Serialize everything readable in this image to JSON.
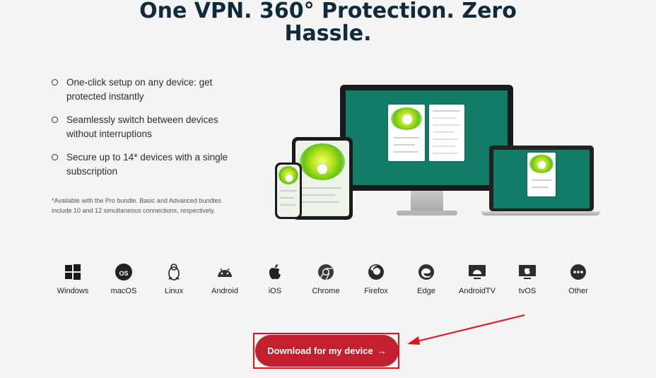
{
  "headline": "One VPN. 360° Protection. Zero Hassle.",
  "features": [
    "One-click setup on any device: get protected instantly",
    "Seamlessly switch between devices without interruptions",
    "Secure up to 14* devices with a single subscription"
  ],
  "footnote": "*Available with the Pro bundle. Basic and Advanced bundles include 10 and 12 simultaneous connections, respectively.",
  "platforms": [
    {
      "label": "Windows",
      "icon": "windows-icon"
    },
    {
      "label": "macOS",
      "icon": "macos-icon"
    },
    {
      "label": "Linux",
      "icon": "linux-icon"
    },
    {
      "label": "Android",
      "icon": "android-icon"
    },
    {
      "label": "iOS",
      "icon": "apple-icon"
    },
    {
      "label": "Chrome",
      "icon": "chrome-icon"
    },
    {
      "label": "Firefox",
      "icon": "firefox-icon"
    },
    {
      "label": "Edge",
      "icon": "edge-icon"
    },
    {
      "label": "AndroidTV",
      "icon": "android-tv-icon"
    },
    {
      "label": "tvOS",
      "icon": "apple-tv-icon"
    },
    {
      "label": "Other",
      "icon": "more-icon"
    }
  ],
  "cta": {
    "label": "Download for my device",
    "arrow": "→"
  },
  "colors": {
    "brand_red": "#c2202f",
    "annotation_red": "#e3121c",
    "screen_green": "#127c69",
    "headline": "#0f2a3a"
  }
}
